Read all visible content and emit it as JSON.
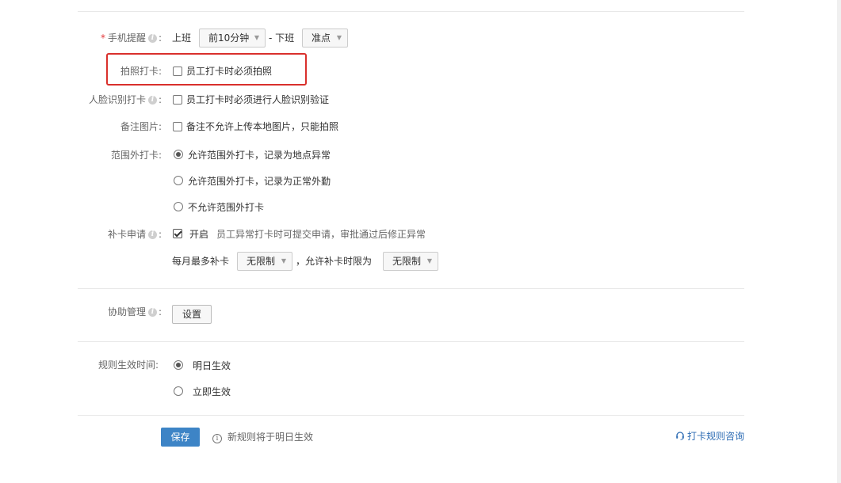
{
  "phone_reminder": {
    "label": "手机提醒",
    "on_duty": "上班",
    "on_duty_select": "前10分钟",
    "separator": "- 下班",
    "off_duty_select": "准点"
  },
  "photo_checkin": {
    "label": "拍照打卡:",
    "option": "员工打卡时必须拍照",
    "checked": false
  },
  "face_recognition": {
    "label": "人脸识别打卡",
    "option": "员工打卡时必须进行人脸识别验证",
    "checked": false
  },
  "remark_image": {
    "label": "备注图片:",
    "option": "备注不允许上传本地图片，只能拍照",
    "checked": false
  },
  "out_of_range": {
    "label": "范围外打卡:",
    "options": [
      {
        "label": "允许范围外打卡，记录为地点异常",
        "selected": true
      },
      {
        "label": "允许范围外打卡，记录为正常外勤",
        "selected": false
      },
      {
        "label": "不允许范围外打卡",
        "selected": false
      }
    ]
  },
  "makeup": {
    "label": "补卡申请",
    "enabled_label": "开启",
    "enabled": true,
    "description": "员工异常打卡时可提交申请，审批通过后修正异常",
    "monthly_label": "每月最多补卡",
    "monthly_select": "无限制",
    "limit_label": "，允许补卡时限为",
    "limit_select": "无限制"
  },
  "assist": {
    "label": "协助管理",
    "button": "设置"
  },
  "effective": {
    "label": "规则生效时间:",
    "options": [
      {
        "label": "明日生效",
        "selected": true
      },
      {
        "label": "立即生效",
        "selected": false
      }
    ]
  },
  "footer": {
    "save": "保存",
    "note": "新规则将于明日生效",
    "consult": "打卡规则咨询"
  }
}
